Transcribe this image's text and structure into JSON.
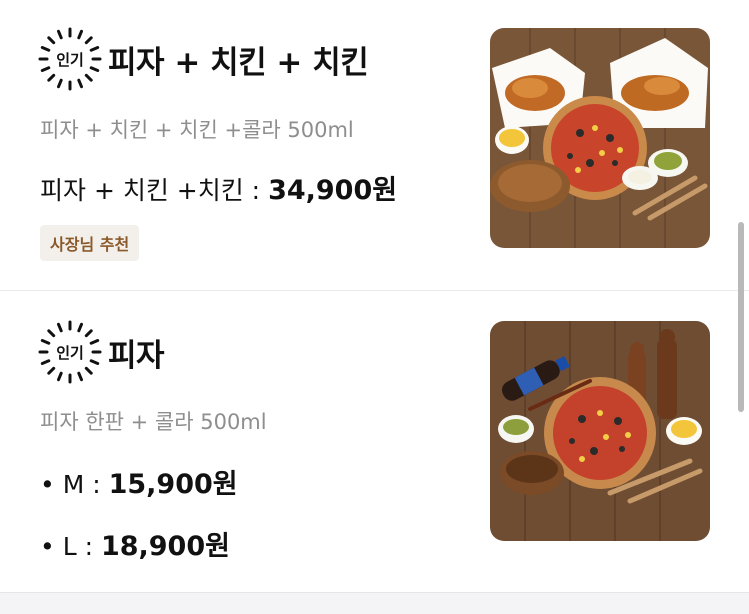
{
  "colors": {
    "accent_tag_bg": "#f3f0ec",
    "accent_tag_text": "#8b5a2b",
    "wood": "#6b4a32"
  },
  "menu_items": [
    {
      "badge": "인기",
      "badge_icon": "popular-badge-icon",
      "title": "피자 + 치킨 + 치킨",
      "description": "피자 + 치킨 + 치킨 +콜라 500ml",
      "price_label": "피자 + 치킨 +치킨 : ",
      "price_value": "34,900원",
      "tag": "사장님 추천",
      "image_icon": "pizza-and-chicken-photo"
    },
    {
      "badge": "인기",
      "badge_icon": "popular-badge-icon",
      "title": "피자",
      "description": "피자 한판 + 콜라 500ml",
      "sizes": [
        {
          "label": "• M : ",
          "price": "15,900원"
        },
        {
          "label": "• L : ",
          "price": "18,900원"
        }
      ],
      "image_icon": "pizza-set-photo"
    }
  ]
}
